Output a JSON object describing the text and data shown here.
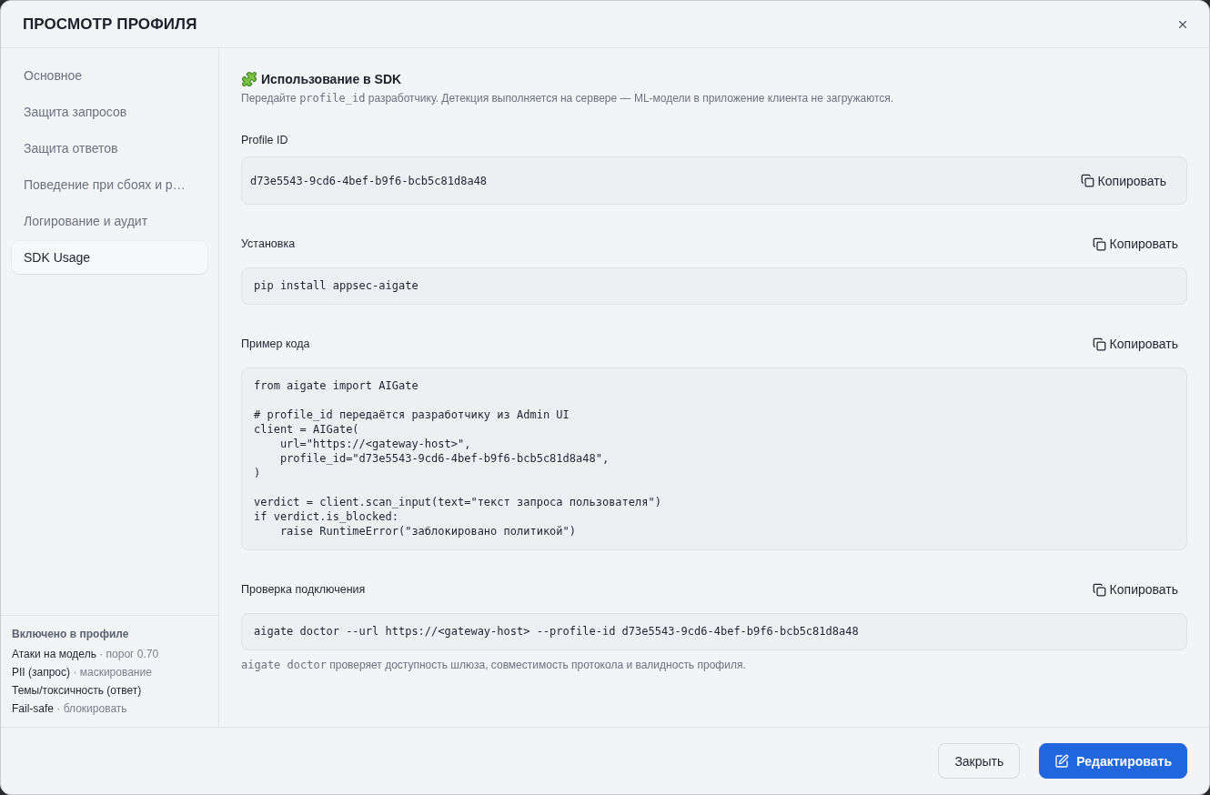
{
  "window": {
    "title": "ПРОСМОТР ПРОФИЛЯ"
  },
  "sidebar": {
    "items": [
      {
        "label": "Основное",
        "selected": false
      },
      {
        "label": "Защита запросов",
        "selected": false
      },
      {
        "label": "Защита ответов",
        "selected": false
      },
      {
        "label": "Поведение при сбоях и р…",
        "selected": false
      },
      {
        "label": "Логирование и аудит",
        "selected": false
      },
      {
        "label": "SDK Usage",
        "selected": true
      }
    ],
    "summary": {
      "title": "Включено в профиле",
      "rows": [
        {
          "name": "Атаки на модель",
          "detail": "· порог 0.70"
        },
        {
          "name": "PII (запрос)",
          "detail": "· маскирование"
        },
        {
          "name": "Темы/токсичность (ответ)"
        },
        {
          "name": "Fail-safe",
          "detail": "· блокировать"
        }
      ]
    }
  },
  "content": {
    "heading": "Использование в SDK",
    "subtitle": [
      {
        "kind": "text",
        "text": "Передайте "
      },
      {
        "kind": "code",
        "text": "profile_id"
      },
      {
        "kind": "text",
        "text": " разработчику. Детекция выполняется на сервере — ML-модели в приложение клиента не загружаются."
      }
    ],
    "sections": [
      {
        "kind": "inline",
        "label": "Profile ID",
        "code": "d73e5543-9cd6-4bef-b9f6-bcb5c81d8a48",
        "copy": "Копировать"
      },
      {
        "kind": "block",
        "label": "Установка",
        "code": "pip install appsec-aigate",
        "copy": "Копировать"
      },
      {
        "kind": "block",
        "label": "Пример кода",
        "code": "from aigate import AIGate\n\n# profile_id передаётся разработчику из Admin UI\nclient = AIGate(\n    url=\"https://<gateway-host>\",\n    profile_id=\"d73e5543-9cd6-4bef-b9f6-bcb5c81d8a48\",\n)\n\nverdict = client.scan_input(text=\"текст запроса пользователя\")\nif verdict.is_blocked:\n    raise RuntimeError(\"заблокировано политикой\")",
        "copy": "Копировать"
      },
      {
        "kind": "block",
        "label": "Проверка подключения",
        "code": "aigate doctor --url https://<gateway-host> --profile-id d73e5543-9cd6-4bef-b9f6-bcb5c81d8a48",
        "copy": "Копировать",
        "note": [
          {
            "kind": "code",
            "text": "aigate doctor"
          },
          {
            "kind": "text",
            "text": " проверяет доступность шлюза, совместимость протокола и валидность профиля."
          }
        ]
      }
    ]
  },
  "footer": {
    "buttons": [
      {
        "kind": "secondary",
        "label": "Закрыть"
      },
      {
        "kind": "primary",
        "label": "Редактировать"
      }
    ]
  }
}
